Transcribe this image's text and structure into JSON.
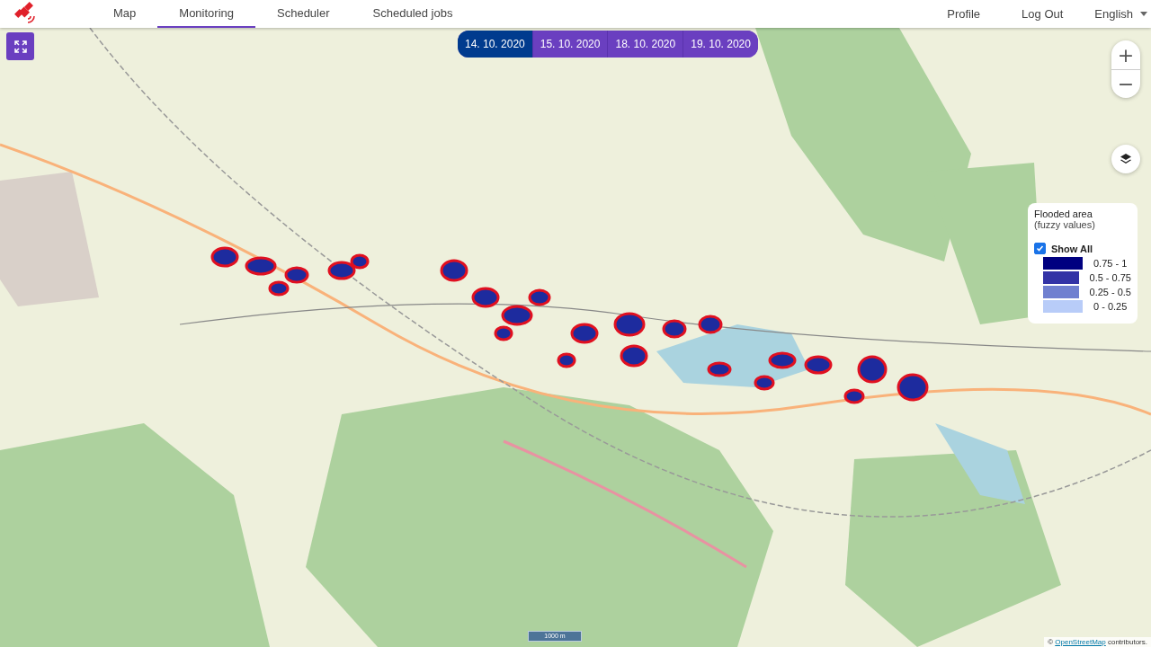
{
  "nav": {
    "items": [
      {
        "label": "Map",
        "selected": false
      },
      {
        "label": "Monitoring",
        "selected": true
      },
      {
        "label": "Scheduler",
        "selected": false
      },
      {
        "label": "Scheduled jobs",
        "selected": false
      }
    ],
    "right": [
      {
        "label": "Profile"
      },
      {
        "label": "Log Out"
      }
    ],
    "language": {
      "value": "English"
    }
  },
  "dates": [
    {
      "label": "14. 10. 2020",
      "selected": true
    },
    {
      "label": "15. 10. 2020",
      "selected": false
    },
    {
      "label": "18. 10. 2020",
      "selected": false
    },
    {
      "label": "19. 10. 2020",
      "selected": false
    }
  ],
  "zoom": {
    "in": "+",
    "out": "−"
  },
  "legend": {
    "title": "Flooded area",
    "subtitle": "(fuzzy values)",
    "show_all": {
      "label": "Show All",
      "checked": true
    },
    "classes": [
      {
        "label": "0.75 - 1",
        "color": "#000080"
      },
      {
        "label": "0.5 - 0.75",
        "color": "#3333a6"
      },
      {
        "label": "0.25 - 0.5",
        "color": "#7080d0"
      },
      {
        "label": "0 - 0.25",
        "color": "#b8ccf8"
      }
    ]
  },
  "scale": "1000 m",
  "attribution": {
    "prefix": "©",
    "link": "OpenStreetMap",
    "suffix": "contributors."
  }
}
